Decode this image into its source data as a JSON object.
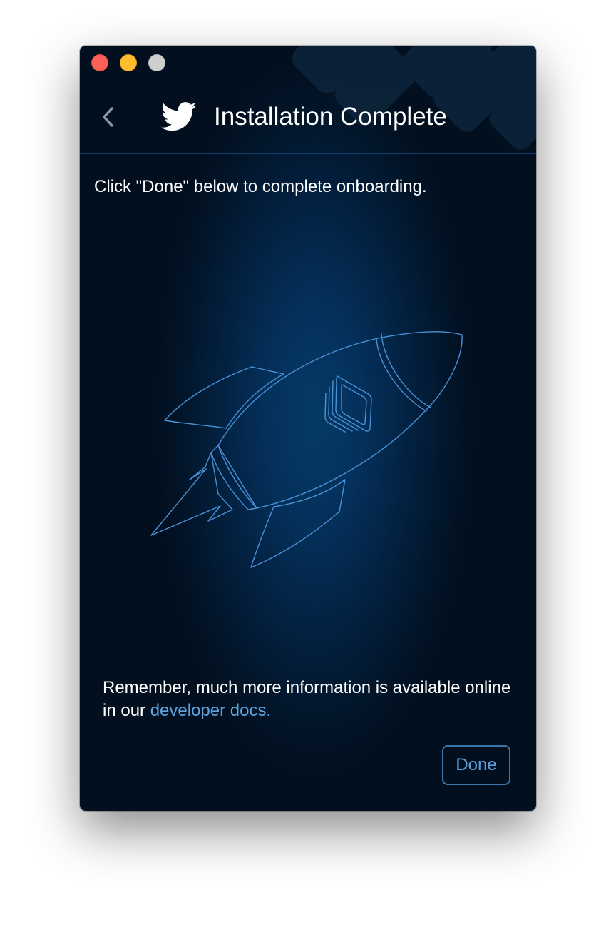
{
  "window": {
    "title": "Installation Complete"
  },
  "titlebar": {
    "buttons": [
      {
        "name": "close",
        "color": "#fe5f57"
      },
      {
        "name": "minimize",
        "color": "#febc2e"
      },
      {
        "name": "zoom",
        "color": "#cfcfcf"
      }
    ]
  },
  "header": {
    "back_icon": "chevron-left-icon",
    "logo_icon": "twitter-bird-icon",
    "title": "Installation Complete"
  },
  "body": {
    "instructions": "Click \"Done\" below to complete onboarding.",
    "illustration": "rocket-icon"
  },
  "footer": {
    "text_before_link": "Remember, much more information is available online in our ",
    "link_text": "developer docs.",
    "done_label": "Done"
  },
  "colors": {
    "background_center": "#063a66",
    "background_edge": "#010f1f",
    "accent_blue": "#5da4e0",
    "divider": "#123f6d",
    "text": "#ffffff"
  }
}
